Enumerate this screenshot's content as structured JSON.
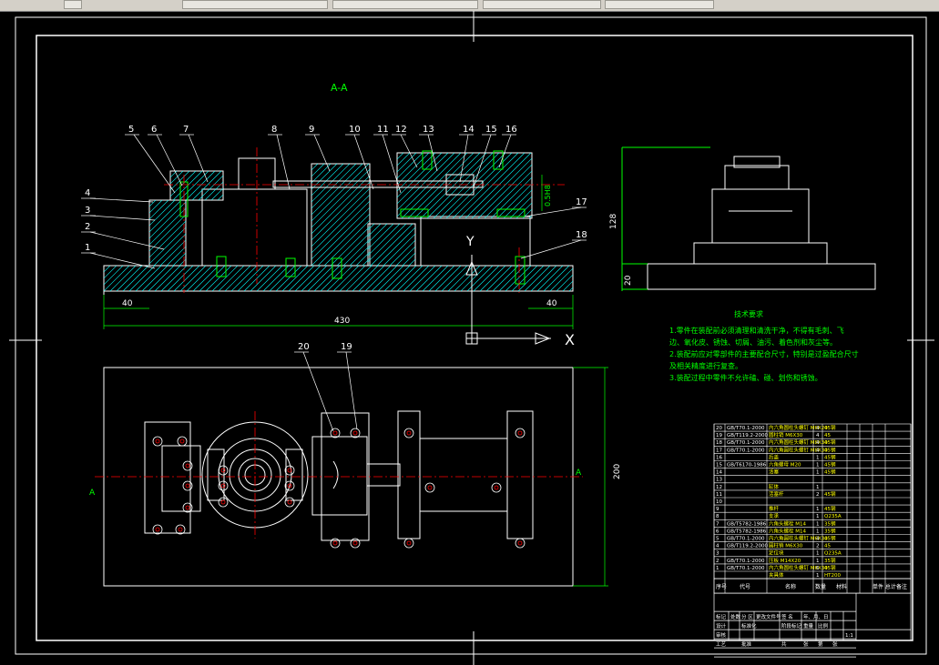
{
  "section_label": "A-A",
  "part_numbers": [
    "1",
    "2",
    "3",
    "4",
    "5",
    "6",
    "7",
    "8",
    "9",
    "10",
    "11",
    "12",
    "13",
    "14",
    "15",
    "16",
    "17",
    "18",
    "19",
    "20"
  ],
  "dimensions": {
    "overall_length": "430",
    "left_offset": "40",
    "right_offset": "40",
    "side_height": "128",
    "side_base": "20",
    "plan_width": "200",
    "tolerance_note": "0.5H8"
  },
  "ucs": {
    "x_label": "X",
    "y_label": "Y"
  },
  "plan_labels": {
    "left_section": "A",
    "right_section": "A"
  },
  "tech_requirements": {
    "title": "技术要求",
    "lines": [
      "1.零件在装配前必须清理和清洗干净，不得有毛刺、飞",
      "边、氧化皮、锈蚀、切屑、油污、着色剂和灰尘等。",
      "2.装配前应对零部件的主要配合尺寸，特别是过盈配合尺寸",
      "及相关精度进行复查。",
      "3.装配过程中零件不允许磕、碰、划伤和锈蚀。"
    ]
  },
  "bom": {
    "rows": [
      {
        "no": "20",
        "code": "GB/T70.1-2000",
        "name": "内六角圆柱头螺钉 M6X20",
        "qty": "4",
        "mat": "45钢"
      },
      {
        "no": "19",
        "code": "GB/T119.2-2000",
        "name": "圆柱销 M6X30",
        "qty": "4",
        "mat": "45"
      },
      {
        "no": "18",
        "code": "GB/T70.1-2000",
        "name": "内六角圆柱头螺钉 M8X30",
        "qty": "4",
        "mat": "45钢"
      },
      {
        "no": "17",
        "code": "GB/T70.1-2000",
        "name": "内六角圆柱头螺钉 M8X30",
        "qty": "4",
        "mat": "45钢"
      },
      {
        "no": "16",
        "code": "",
        "name": "后盖",
        "qty": "1",
        "mat": "45钢"
      },
      {
        "no": "15",
        "code": "GB/T6170-1986",
        "name": "六角螺母 M20",
        "qty": "1",
        "mat": "45钢"
      },
      {
        "no": "14",
        "code": "",
        "name": "活塞",
        "qty": "1",
        "mat": "45钢"
      },
      {
        "no": "13",
        "code": "",
        "name": "",
        "qty": "",
        "mat": ""
      },
      {
        "no": "12",
        "code": "",
        "name": "缸体",
        "qty": "1",
        "mat": ""
      },
      {
        "no": "11",
        "code": "",
        "name": "活塞杆",
        "qty": "2",
        "mat": "45钢"
      },
      {
        "no": "10",
        "code": "",
        "name": "",
        "qty": "",
        "mat": ""
      },
      {
        "no": "9",
        "code": "",
        "name": "推杆",
        "qty": "1",
        "mat": "45钢"
      },
      {
        "no": "8",
        "code": "",
        "name": "支承",
        "qty": "1",
        "mat": "Q235A"
      },
      {
        "no": "7",
        "code": "GB/T5782-1986",
        "name": "六角头螺栓 M14",
        "qty": "1",
        "mat": "35钢"
      },
      {
        "no": "6",
        "code": "GB/T5782-1986",
        "name": "六角头螺栓 M14",
        "qty": "1",
        "mat": "35钢"
      },
      {
        "no": "5",
        "code": "GB/T70.1-2000",
        "name": "内六角圆柱头螺钉 M6X30",
        "qty": "4",
        "mat": "45钢"
      },
      {
        "no": "4",
        "code": "GB/T119.2-2000",
        "name": "圆柱销 M6X30",
        "qty": "2",
        "mat": "45"
      },
      {
        "no": "3",
        "code": "",
        "name": "定位块",
        "qty": "1",
        "mat": "Q235A"
      },
      {
        "no": "2",
        "code": "GB/T70.1-2000",
        "name": "压板 M14X20",
        "qty": "1",
        "mat": "35钢"
      },
      {
        "no": "1",
        "code": "GB/T70.1-2000",
        "name": "内六角圆柱头螺钉 M6X30",
        "qty": "6",
        "mat": "45钢"
      },
      {
        "no": "",
        "code": "",
        "name": "夹具体",
        "qty": "1",
        "mat": "HT200"
      }
    ],
    "header": {
      "no": "序号",
      "code": "代号",
      "name": "名称",
      "qty": "数量",
      "mat": "材料",
      "weight": "单件 总计",
      "note": "备注"
    }
  },
  "title_block": {
    "row1": [
      "标记",
      "处数",
      "分 区",
      "更改文件号",
      "签 名",
      "年、月、日"
    ],
    "row2": [
      "设计",
      "",
      "标准化",
      "",
      "阶段标记",
      "重量",
      "比例"
    ],
    "row3": [
      "审核",
      "",
      "",
      "",
      ""
    ],
    "row4": [
      "工艺",
      "",
      "批准",
      "",
      "共",
      "张",
      "第",
      "张"
    ],
    "scale": "1:1"
  },
  "colors": {
    "background": "#000000",
    "line": "#ffffff",
    "center": "#ff0000",
    "part": "#00ff00",
    "hatch": "#00ffff",
    "dim": "#00ff00",
    "text_yellow": "#ffff00",
    "highlight": "#ff00ff"
  }
}
